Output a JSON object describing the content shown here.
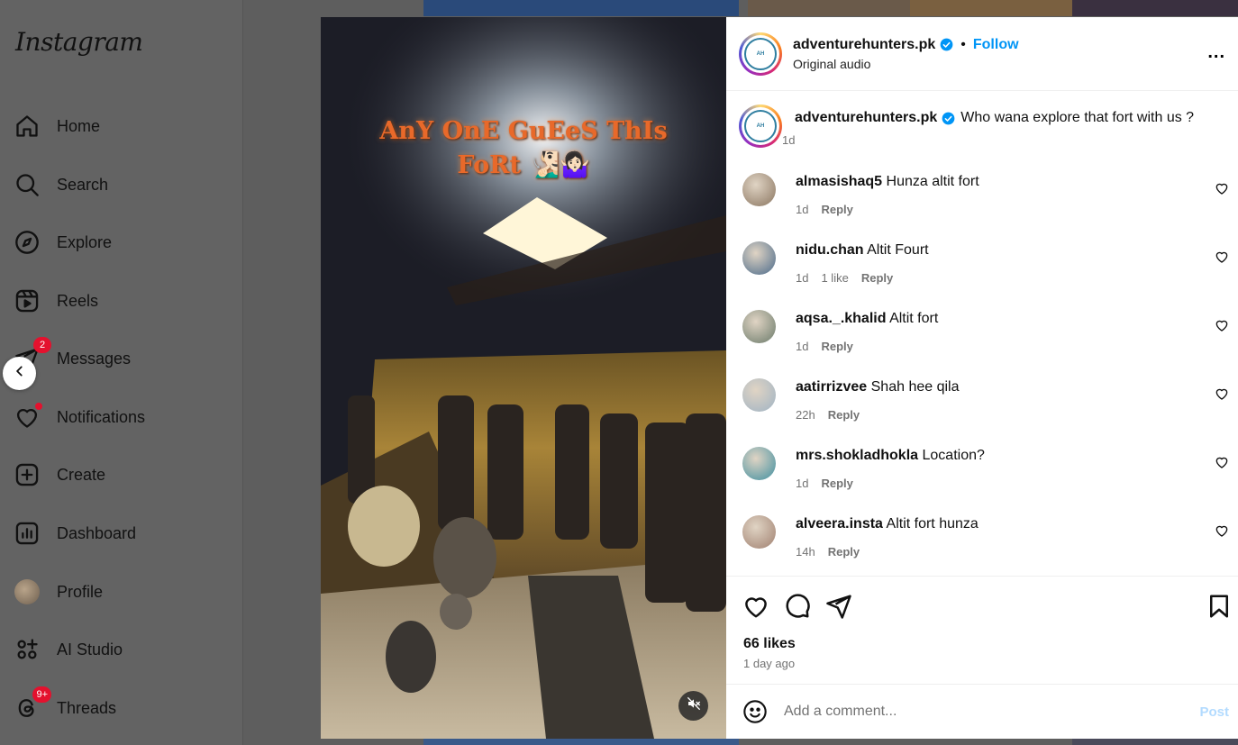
{
  "sidebar": {
    "logo": "Instagram",
    "items": [
      {
        "label": "Home",
        "icon": "home-icon"
      },
      {
        "label": "Search",
        "icon": "search-icon"
      },
      {
        "label": "Explore",
        "icon": "compass-icon"
      },
      {
        "label": "Reels",
        "icon": "reels-icon"
      },
      {
        "label": "Messages",
        "icon": "messenger-icon",
        "badge": "2"
      },
      {
        "label": "Notifications",
        "icon": "heart-icon",
        "dot": true
      },
      {
        "label": "Create",
        "icon": "plus-square-icon"
      },
      {
        "label": "Dashboard",
        "icon": "dashboard-icon"
      },
      {
        "label": "Profile",
        "icon": "profile-avatar"
      },
      {
        "label": "AI Studio",
        "icon": "ai-studio-icon"
      },
      {
        "label": "Threads",
        "icon": "threads-icon",
        "badge": "9+"
      }
    ]
  },
  "video": {
    "overlay_line1": "AnY OnE GuEeS ThIs",
    "overlay_line2": "FoRt 🧏🏻‍♂️🤷🏻‍♀️",
    "muted": true
  },
  "post": {
    "username": "adventurehunters.pk",
    "verified": true,
    "separator": "•",
    "follow_label": "Follow",
    "audio": "Original audio",
    "caption": {
      "username": "adventurehunters.pk",
      "text": "Who wana explore that fort with us ?",
      "time": "1d"
    },
    "comments": [
      {
        "username": "almasishaq5",
        "text": "Hunza altit fort",
        "time": "1d",
        "likes": "",
        "reply": "Reply",
        "avatar_color": "#8a7560"
      },
      {
        "username": "nidu.chan",
        "text": "Altit Fourt",
        "time": "1d",
        "likes": "1 like",
        "reply": "Reply",
        "avatar_color": "#4a6a8a"
      },
      {
        "username": "aqsa._.khalid",
        "text": "Altit fort",
        "time": "1d",
        "likes": "",
        "reply": "Reply",
        "avatar_color": "#6a7a6a"
      },
      {
        "username": "aatirrizvee",
        "text": "Shah hee qila",
        "time": "22h",
        "likes": "",
        "reply": "Reply",
        "avatar_color": "#9fb3c4"
      },
      {
        "username": "mrs.shokladhokla",
        "text": "Location?",
        "time": "1d",
        "likes": "",
        "reply": "Reply",
        "avatar_color": "#3f8fa0"
      },
      {
        "username": "alveera.insta",
        "text": "Altit fort hunza",
        "time": "14h",
        "likes": "",
        "reply": "Reply",
        "avatar_color": "#a08070"
      }
    ],
    "likes": "66 likes",
    "time_ago": "1 day ago",
    "comment_placeholder": "Add a comment...",
    "post_label": "Post",
    "more": "..."
  },
  "colors": {
    "accent": "#0095f6",
    "badge": "#e4112e",
    "post_disabled": "#b3dbff",
    "overlay_text": "#e8692a"
  }
}
